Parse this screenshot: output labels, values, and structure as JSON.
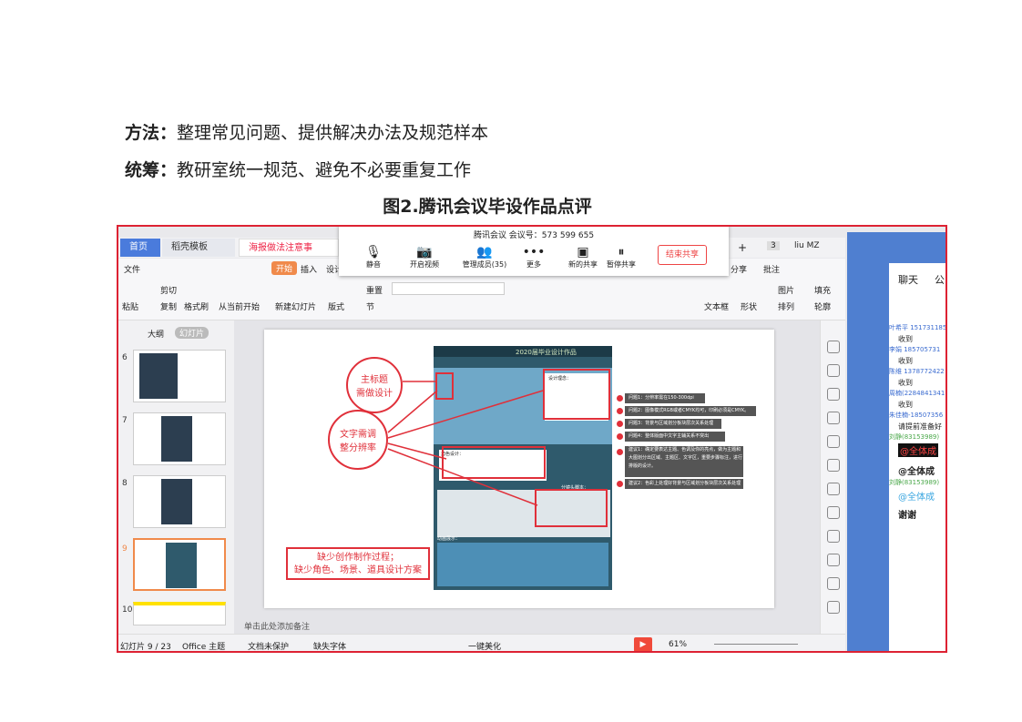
{
  "doc": {
    "line1_label": "方法：",
    "line1_text": "整理常见问题、提供解决办法及规范样本",
    "line2_label": "统筹：",
    "line2_text": "教研室统一规范、避免不必要重复工作",
    "caption": "图2.腾讯会议毕设作品点评"
  },
  "meeting": {
    "title": "腾讯会议 会议号：573 599 655",
    "buttons": [
      "静音",
      "开启视频",
      "管理成员(35)",
      "更多",
      "新的共享",
      "暂停共享"
    ],
    "end_share": "结束共享"
  },
  "wps": {
    "tabs": [
      "首页",
      "稻壳模板",
      "海报做法注意事项.pptx"
    ],
    "user": "liu MZ",
    "tab_count": "3",
    "menu": [
      "文件",
      "开始",
      "插入",
      "设计"
    ],
    "menu_right": [
      "分享",
      "批注"
    ],
    "ribbon": [
      "粘贴",
      "剪切",
      "复制",
      "格式刷",
      "从当前开始",
      "新建幻灯片",
      "版式",
      "节",
      "重置",
      "文本框",
      "形状",
      "排列",
      "图片",
      "填充",
      "轮廓"
    ],
    "panel_tabs": [
      "大纲",
      "幻灯片"
    ],
    "slide_numbers": [
      "6",
      "7",
      "8",
      "9",
      "10"
    ],
    "notes_placeholder": "单击此处添加备注",
    "status": {
      "slide": "幻灯片 9 / 23",
      "theme": "Office 主题",
      "protect": "文档未保护",
      "font": "缺失字体",
      "beautify": "一键美化",
      "zoom": "61%"
    }
  },
  "slide": {
    "poster_title": "2020届毕业设计作品",
    "circle1": "主标题\n需做设计",
    "circle2": "文字需调\n整分辨率",
    "box_note": "缺少创作制作过程；\n缺少角色、场景、道具设计方案",
    "issues": [
      "问题1：分辨率需在150-300dpi",
      "问题2：图像模式RGB或者CMYK均可，印刷必须是CMYK。",
      "问题3：背景与区域划分板块层次关系处理",
      "问题4：整体版面中文字主辅关系不突出",
      "建议1：确定要表达主题、色调及你的亮点，做为主题和大图划分出区域、主题区、文字区，重要步骤标注，进行排版的设计。",
      "建议2：色彩上处理好背景与区域划分板块层次关系处理"
    ],
    "poster_labels": [
      "设计理念：",
      "角色设计：",
      "分镜头脚本：",
      "动画展示："
    ]
  },
  "chat": {
    "tab": "聊天",
    "tab2": "公",
    "messages": [
      {
        "name": "叶希平 151731185",
        "text": "收到"
      },
      {
        "name": "李娟 185705731",
        "text": "收到"
      },
      {
        "name": "陈维 1378772422",
        "text": "收到"
      },
      {
        "name": "周楠(2284841341",
        "text": "收到"
      },
      {
        "name": "朱佳楠-18507356",
        "text": "请提前准备好"
      },
      {
        "name": "刘静(83153989)",
        "text": "@全体成"
      },
      {
        "name": "",
        "text": "@全体成"
      },
      {
        "name": "刘静(83153989)",
        "text": "@全体成"
      },
      {
        "name": "",
        "text": "谢谢"
      }
    ]
  },
  "colors": {
    "accent_red": "#e0303a",
    "wps_blue": "#4a7bdc",
    "chat_blue": "#4f7fd0",
    "poster_bg": "#2f5a6c"
  }
}
